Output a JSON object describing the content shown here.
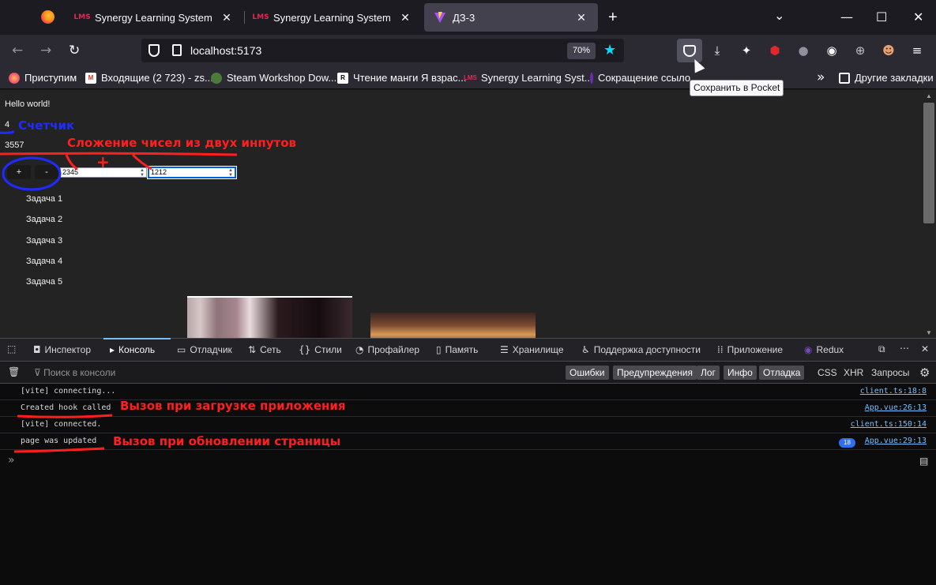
{
  "tabs": [
    {
      "title": "Synergy Learning System",
      "favicon": "LMS",
      "active": false
    },
    {
      "title": "Synergy Learning System",
      "favicon": "LMS",
      "active": false
    },
    {
      "title": "ДЗ-3",
      "favicon": "vite-icon",
      "active": true
    }
  ],
  "window_controls": {
    "list_all_tabs": "⌄",
    "minimize": "—",
    "maximize": "☐",
    "close": "✕"
  },
  "nav": {
    "url": "localhost:5173",
    "zoom": "70%"
  },
  "bookmarks": [
    {
      "label": "Приступим",
      "icon": "firefox-icon"
    },
    {
      "label": "Входящие (2 723) - zs...",
      "icon": "gmail-icon"
    },
    {
      "label": "Steam Workshop Dow...",
      "icon": "steam-icon"
    },
    {
      "label": "Чтение манги Я взрас...",
      "icon": "manga-icon"
    },
    {
      "label": "Synergy Learning Syst...",
      "icon": "LMS"
    },
    {
      "label": "Сокращение ссылок",
      "icon": "link-icon"
    }
  ],
  "bookmarks_other": "Другие закладки",
  "tooltip": "Сохранить в Pocket",
  "page": {
    "hello": "Hello world!",
    "counter": "4",
    "sum": "3557",
    "plus_label": "+",
    "minus_label": "-",
    "input_a": "2345",
    "input_b": "1212",
    "tasks": [
      "Задача 1",
      "Задача 2",
      "Задача 3",
      "Задача 4",
      "Задача 5"
    ]
  },
  "annotations": {
    "counter": "Счетчик",
    "sum": "Сложение чисел из двух инпутов",
    "plus": "+",
    "created": "Вызов при загрузке приложения",
    "updated": "Вызов при обновлении страницы"
  },
  "devtools": {
    "tabs": [
      "Инспектор",
      "Консоль",
      "Отладчик",
      "Сеть",
      "Стили",
      "Профайлер",
      "Память",
      "Хранилище",
      "Поддержка доступности",
      "Приложение",
      "Redux"
    ],
    "active_tab": "Консоль",
    "filter_placeholder": "Поиск в консоли",
    "levels": [
      "Ошибки",
      "Предупреждения",
      "Лог",
      "Инфо",
      "Отладка"
    ],
    "extra_filters": [
      "CSS",
      "XHR",
      "Запросы"
    ],
    "messages": [
      {
        "text": "[vite] connecting...",
        "source": "client.ts:18:8"
      },
      {
        "text": "Created hook called",
        "source": "App.vue:26:13"
      },
      {
        "text": "[vite] connected.",
        "source": "client.ts:150:14"
      },
      {
        "text": "page was updated",
        "source": "App.vue:29:13",
        "count": "18"
      }
    ],
    "prompt": "»"
  },
  "colors": {
    "accent": "#00ddff",
    "annotation_red": "#ff1f1f",
    "annotation_blue": "#1f2cff",
    "link": "#75bfff"
  }
}
